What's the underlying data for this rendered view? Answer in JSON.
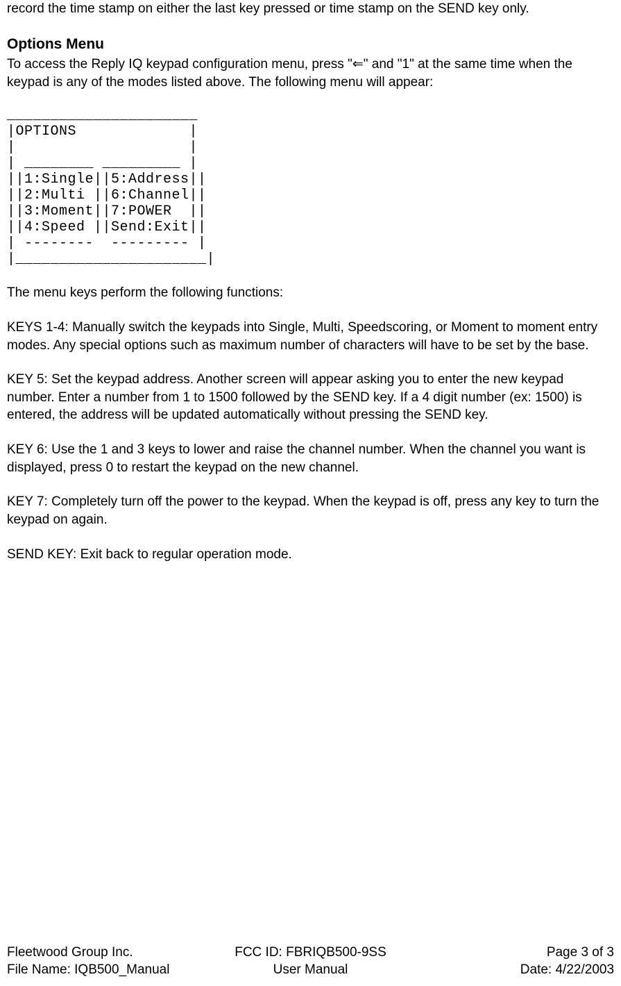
{
  "body": {
    "intro": "record the time stamp on either the last key pressed or time stamp on the SEND key only.",
    "heading": "Options Menu",
    "access_1": "To access the Reply IQ keypad configuration menu, press \"",
    "access_arrow": "⇐",
    "access_2": "\"  and \"1\" at the same time when the keypad is any of the modes listed above.    The following menu will appear:",
    "mono": "______________________\n|OPTIONS             |\n|                    |\n| ________ _________ |\n||1:Single||5:Address||\n||2:Multi ||6:Channel||\n||3:Moment||7:POWER  ||\n||4:Speed ||Send:Exit||\n| --------  --------- |\n|______________________|",
    "menu_intro": "The menu keys perform the following functions:",
    "keys14": "KEYS 1-4:  Manually switch the keypads into Single, Multi, Speedscoring, or Moment to moment entry modes.  Any special options such as maximum number of characters will have to be set by the base.",
    "key5": "KEY 5: Set the keypad address.  Another screen will appear asking you to enter the new keypad number.  Enter a number from 1 to 1500 followed by the SEND key.  If a 4 digit number (ex: 1500) is entered, the address will be updated  automatically without pressing the SEND key.",
    "key6": "KEY 6: Use the 1 and 3 keys to lower and raise the channel number.  When the channel you want is displayed, press 0 to restart the keypad on the new channel.",
    "key7": "KEY 7: Completely turn off the power to the keypad.  When the keypad is off, press any key to turn the keypad on again.",
    "sendkey": "SEND KEY: Exit back to regular operation mode."
  },
  "footer": {
    "row1": {
      "left": "Fleetwood Group Inc.",
      "center": "FCC ID:  FBRIQB500-9SS",
      "right": "Page 3 of 3"
    },
    "row2": {
      "left": "File Name: IQB500_Manual",
      "center": "User Manual",
      "right": "Date: 4/22/2003"
    }
  }
}
